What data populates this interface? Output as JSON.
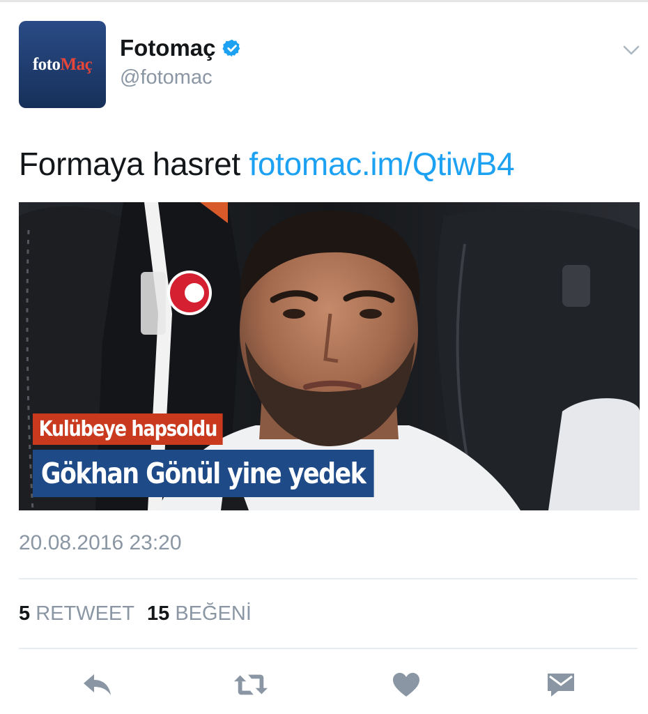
{
  "tweet": {
    "account": {
      "avatar_text_a": "foto",
      "avatar_text_b": "Maç",
      "name": "Fotomaç",
      "handle": "@fotomac",
      "verified_icon": "verified-badge-icon"
    },
    "text": {
      "body": "Formaya hasret",
      "link": "fotomac.im/QtiwB4"
    },
    "media": {
      "caption_top": "Kulübeye hapsoldu",
      "caption_bottom": "Gökhan Gönül yine yedek"
    },
    "timestamp": "20.08.2016 23:20",
    "stats": {
      "retweet_count": "5",
      "retweet_label": "RETWEET",
      "like_count": "15",
      "like_label": "BEĞENİ"
    },
    "actions": [
      "reply-icon",
      "retweet-icon",
      "like-icon",
      "message-icon"
    ],
    "colors": {
      "link": "#1da1f2",
      "secondary_text": "#8a96a3",
      "icon": "#8a96a3",
      "caption_red": "#c8391e",
      "caption_blue": "#1e4a88"
    }
  }
}
